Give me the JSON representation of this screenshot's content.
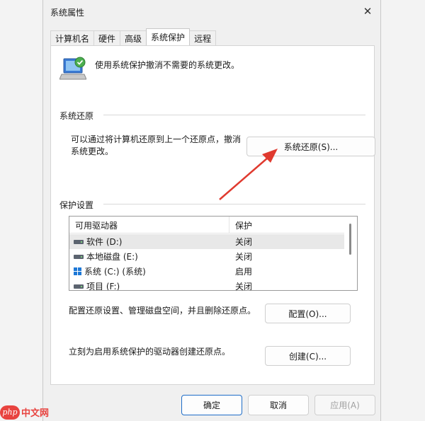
{
  "window": {
    "title": "系统属性",
    "close_glyph": "✕"
  },
  "tabs": [
    {
      "label": "计算机名"
    },
    {
      "label": "硬件"
    },
    {
      "label": "高级"
    },
    {
      "label": "系统保护",
      "active": true
    },
    {
      "label": "远程"
    }
  ],
  "intro_text": "使用系统保护撤消不需要的系统更改。",
  "restore_group": {
    "title": "系统还原",
    "desc_line1": "可以通过将计算机还原到上一个还原点，撤消",
    "desc_line2": "系统更改。",
    "button_label": "系统还原(S)..."
  },
  "protection_group": {
    "title": "保护设置",
    "columns": [
      "可用驱动器",
      "保护"
    ],
    "drives": [
      {
        "name": "软件 (D:)",
        "protection": "关闭",
        "icon": "drive-icon",
        "selected": true
      },
      {
        "name": "本地磁盘 (E:)",
        "protection": "关闭",
        "icon": "drive-icon"
      },
      {
        "name": "系统 (C:) (系统)",
        "protection": "启用",
        "icon": "windows-drive-icon"
      },
      {
        "name": "项目 (F:)",
        "protection": "关闭",
        "icon": "drive-icon"
      }
    ],
    "configure_desc": "配置还原设置、管理磁盘空间，并且删除还原点。",
    "configure_label": "配置(O)...",
    "create_desc": "立刻为启用系统保护的驱动器创建还原点。",
    "create_label": "创建(C)..."
  },
  "footer": {
    "ok_label": "确定",
    "cancel_label": "取消",
    "apply_label": "应用(A)"
  },
  "watermark": {
    "badge": "php",
    "text": "中文网"
  },
  "colors": {
    "accent": "#1e6dc8",
    "annotation_arrow": "#e03a2f",
    "watermark": "#e8433f"
  }
}
